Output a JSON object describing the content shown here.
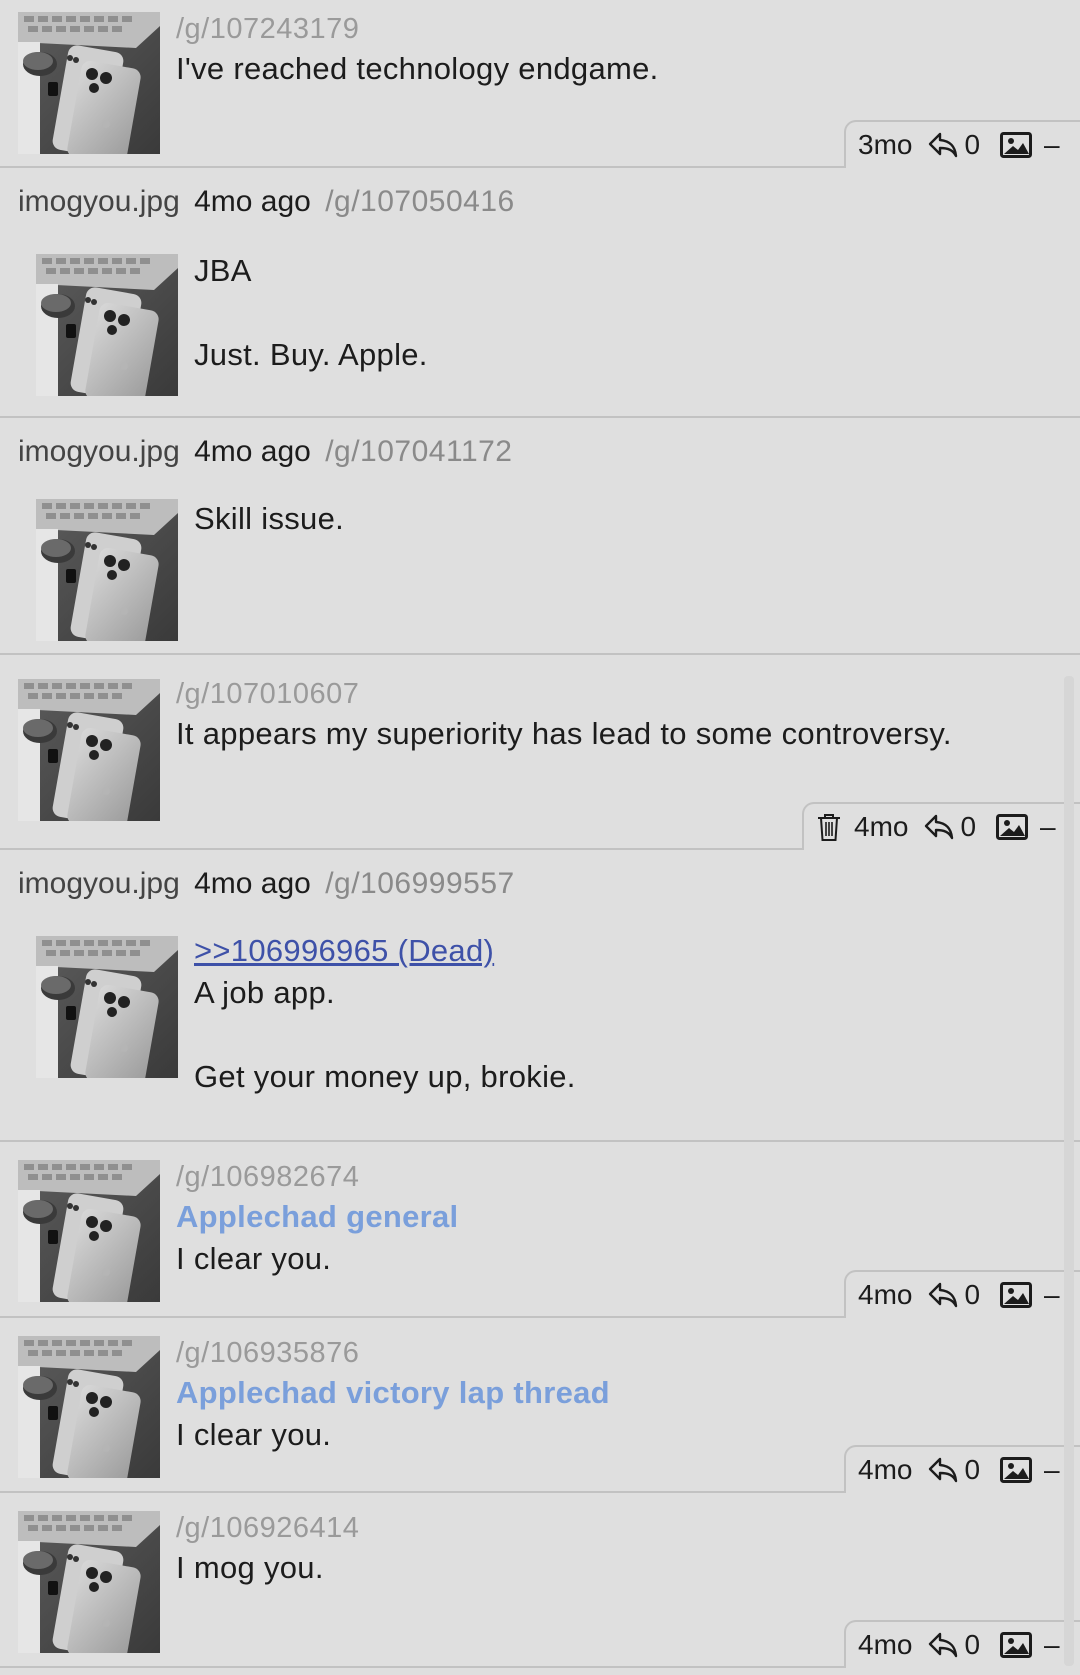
{
  "feed": {
    "items": [
      {
        "kind": "thread",
        "board_id": "/g/107243179",
        "text": "I've reached technology endgame.",
        "meta": {
          "age": "3mo",
          "replies": "0",
          "delete_icon": false
        }
      },
      {
        "kind": "reply",
        "filename": "imogyou.jpg",
        "ago": "4mo ago",
        "board_id": "/g/107050416",
        "lines": [
          "JBA",
          "",
          "Just. Buy. Apple."
        ]
      },
      {
        "kind": "reply",
        "filename": "imogyou.jpg",
        "ago": "4mo ago",
        "board_id": "/g/107041172",
        "lines": [
          "Skill issue."
        ]
      },
      {
        "kind": "thread",
        "board_id": "/g/107010607",
        "text": "It appears my superiority has lead to some controversy.",
        "meta": {
          "age": "4mo",
          "replies": "0",
          "delete_icon": true
        }
      },
      {
        "kind": "reply",
        "filename": "imogyou.jpg",
        "ago": "4mo ago",
        "board_id": "/g/106999557",
        "quote": ">>106996965 (Dead)",
        "lines": [
          "A job app.",
          "",
          "Get your money up, brokie."
        ]
      },
      {
        "kind": "thread",
        "board_id": "/g/106982674",
        "subject": "Applechad general",
        "text": "I clear you.",
        "meta": {
          "age": "4mo",
          "replies": "0",
          "delete_icon": false
        }
      },
      {
        "kind": "thread",
        "board_id": "/g/106935876",
        "subject": "Applechad victory lap thread",
        "text": "I clear you.",
        "meta": {
          "age": "4mo",
          "replies": "0",
          "delete_icon": false
        }
      },
      {
        "kind": "thread",
        "board_id": "/g/106926414",
        "text": "I mog you.",
        "meta": {
          "age": "4mo",
          "replies": "0",
          "delete_icon": false
        }
      }
    ],
    "icons": {
      "reply": "reply-arrow-icon",
      "image": "image-icon",
      "delete": "trash-icon",
      "collapse": "minus-icon"
    },
    "colors": {
      "background": "#dfdfdf",
      "subject": "#7a9fdb",
      "quote_link": "#3e51a8",
      "board_id": "#9a9a9a"
    }
  }
}
